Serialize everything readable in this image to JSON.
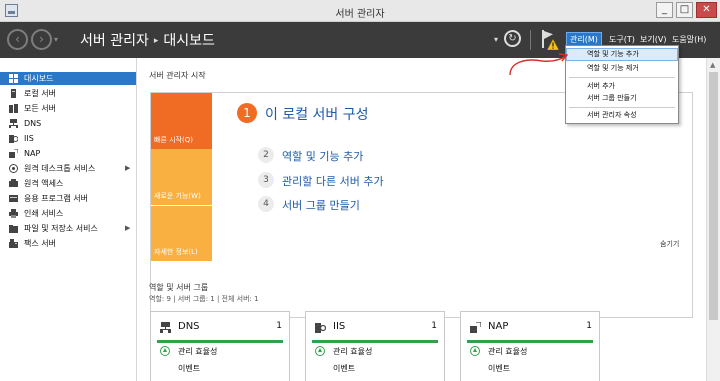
{
  "window": {
    "title": "서버 관리자",
    "controls": {
      "minimize": "_",
      "maximize": "□",
      "close": "✕"
    }
  },
  "header": {
    "breadcrumb_root": "서버 관리자",
    "breadcrumb_sep": "▸",
    "breadcrumb_current": "대시보드",
    "menus": [
      {
        "label": "관리(M)"
      },
      {
        "label": "도구(T)"
      },
      {
        "label": "보기(V)"
      },
      {
        "label": "도움말(H)"
      }
    ]
  },
  "manage_dropdown": {
    "items": [
      "역할 및 기능 추가",
      "역할 및 기능 제거",
      "서버 추가",
      "서버 그룹 만들기",
      "서버 관리자 속성"
    ]
  },
  "sidebar": {
    "items": [
      {
        "label": "대시보드",
        "icon": "dashboard-icon",
        "active": true
      },
      {
        "label": "로컬 서버",
        "icon": "server-icon"
      },
      {
        "label": "모든 서버",
        "icon": "servers-icon"
      },
      {
        "label": "DNS",
        "icon": "dns-icon"
      },
      {
        "label": "IIS",
        "icon": "iis-icon"
      },
      {
        "label": "NAP",
        "icon": "nap-icon"
      },
      {
        "label": "원격 데스크톱 서비스",
        "icon": "remote-desktop-icon",
        "expandable": true
      },
      {
        "label": "원격 액세스",
        "icon": "remote-access-icon"
      },
      {
        "label": "응용 프로그램 서버",
        "icon": "app-server-icon"
      },
      {
        "label": "인쇄 서비스",
        "icon": "printer-icon"
      },
      {
        "label": "파일 및 저장소 서비스",
        "icon": "folder-icon",
        "expandable": true
      },
      {
        "label": "팩스 서버",
        "icon": "fax-icon"
      }
    ]
  },
  "main": {
    "title": "서버 관리자 시작",
    "quickstart": {
      "tiles": [
        "빠른 시작(Q)",
        "새로운 기능(W)",
        "자세한 정보(L)"
      ],
      "heading_num": "1",
      "heading": "이 로컬 서버 구성",
      "steps": [
        {
          "num": "2",
          "label": "역할 및 기능 추가"
        },
        {
          "num": "3",
          "label": "관리할 다른 서버 추가"
        },
        {
          "num": "4",
          "label": "서버 그룹 만들기"
        }
      ],
      "hide": "숨기기"
    },
    "roles": {
      "title": "역할 및 서버 그룹",
      "summary": "역할: 9   |   서버 그룹: 1   |   전체 서버: 1",
      "cards": [
        {
          "name": "DNS",
          "count": "1",
          "icon": "dns-icon",
          "status": "관리 효율성",
          "events": "이벤트"
        },
        {
          "name": "IIS",
          "count": "1",
          "icon": "iis-icon",
          "status": "관리 효율성",
          "events": "이벤트"
        },
        {
          "name": "NAP",
          "count": "1",
          "icon": "nap-icon",
          "status": "관리 효율성",
          "events": "이벤트"
        }
      ]
    }
  },
  "colors": {
    "accent": "#2b78c8",
    "header_bg": "#3b3b3b",
    "quickstart_orange": "#f06b24",
    "tile_yellow": "#f9b041",
    "status_green": "#2fa34a",
    "annotation_red": "#d2312b"
  }
}
